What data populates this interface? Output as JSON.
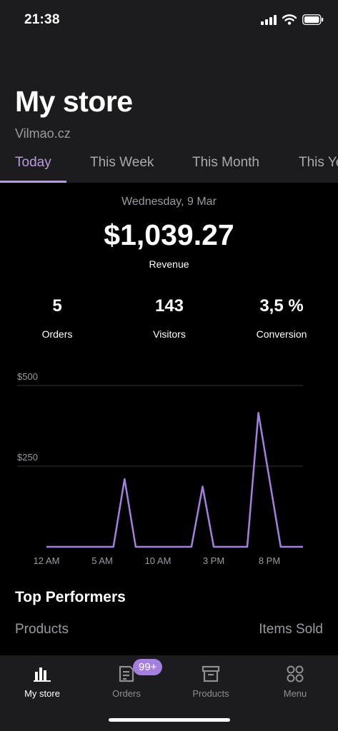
{
  "status_bar": {
    "time": "21:38"
  },
  "header": {
    "title": "My store",
    "subtitle": "Vilmao.cz",
    "tabs": [
      {
        "label": "Today",
        "active": true
      },
      {
        "label": "This Week"
      },
      {
        "label": "This Month"
      },
      {
        "label": "This Year"
      }
    ]
  },
  "summary": {
    "date": "Wednesday, 9 Mar",
    "revenue": "$1,039.27",
    "revenue_label": "Revenue",
    "stats": [
      {
        "value": "5",
        "label": "Orders"
      },
      {
        "value": "143",
        "label": "Visitors"
      },
      {
        "value": "3,5 %",
        "label": "Conversion"
      }
    ]
  },
  "chart_data": {
    "type": "line",
    "x_labels": [
      "12 AM",
      "5 AM",
      "10 AM",
      "3 PM",
      "8 PM"
    ],
    "y_tick_labels": [
      "$500",
      "$250"
    ],
    "y_ticks": [
      500,
      250
    ],
    "ylim": [
      0,
      500
    ],
    "grid": true,
    "color": "#a57fe0",
    "points": [
      {
        "x": 0,
        "y": 0
      },
      {
        "x": 6,
        "y": 0
      },
      {
        "x": 7,
        "y": 210
      },
      {
        "x": 8,
        "y": 0
      },
      {
        "x": 13,
        "y": 0
      },
      {
        "x": 14,
        "y": 187
      },
      {
        "x": 15,
        "y": 0
      },
      {
        "x": 18,
        "y": 0
      },
      {
        "x": 19,
        "y": 415
      },
      {
        "x": 21,
        "y": 0
      },
      {
        "x": 23,
        "y": 0
      }
    ]
  },
  "top_performers": {
    "title": "Top Performers",
    "col_left": "Products",
    "col_right": "Items Sold"
  },
  "tab_bar": {
    "items": [
      {
        "label": "My store",
        "icon": "bar-chart-icon",
        "active": true
      },
      {
        "label": "Orders",
        "icon": "orders-icon",
        "badge": "99+"
      },
      {
        "label": "Products",
        "icon": "archive-box-icon"
      },
      {
        "label": "Menu",
        "icon": "grid-circles-icon"
      }
    ]
  },
  "colors": {
    "accent": "#a57fe0",
    "tab_accent": "#b89be0",
    "header_bg": "#1c1c1e",
    "background": "#000000"
  }
}
